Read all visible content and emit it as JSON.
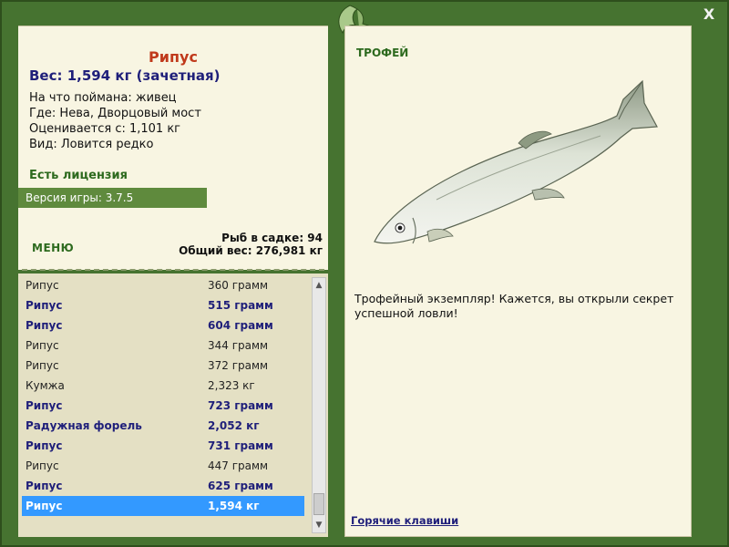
{
  "fish": {
    "name": "Рипус",
    "weight_line": "Вес: 1,594 кг (зачетная)",
    "info": [
      "На что поймана: живец",
      "Где: Нева, Дворцовый мост",
      "Оценивается с: 1,101 кг",
      "Вид: Ловится редко"
    ]
  },
  "license": "Есть лицензия",
  "version": "Версия игры: 3.7.5",
  "menu_label": "МЕНЮ",
  "stats": {
    "count_line": "Рыб в садке: 94",
    "total_line": "Общий вес: 276,981 кг"
  },
  "list": [
    {
      "name": "Рипус",
      "weight": "360 грамм",
      "bold": false
    },
    {
      "name": "Рипус",
      "weight": "515 грамм",
      "bold": true
    },
    {
      "name": "Рипус",
      "weight": "604 грамм",
      "bold": true
    },
    {
      "name": "Рипус",
      "weight": "344 грамм",
      "bold": false
    },
    {
      "name": "Рипус",
      "weight": "372 грамм",
      "bold": false
    },
    {
      "name": "Кумжа",
      "weight": "2,323 кг",
      "bold": false
    },
    {
      "name": "Рипус",
      "weight": "723 грамм",
      "bold": true
    },
    {
      "name": "Радужная форель",
      "weight": "2,052 кг",
      "bold": true
    },
    {
      "name": "Рипус",
      "weight": "731 грамм",
      "bold": true
    },
    {
      "name": "Рипус",
      "weight": "447 грамм",
      "bold": false
    },
    {
      "name": "Рипус",
      "weight": "625 грамм",
      "bold": true
    },
    {
      "name": "Рипус",
      "weight": "1,594 кг",
      "bold": true,
      "selected": true
    }
  ],
  "trophy": {
    "label": "ТРОФЕЙ",
    "text": "Трофейный экземпляр! Кажется, вы открыли секрет успешной ловли!"
  },
  "hotkeys": "Горячие клавиши",
  "close_glyph": "X"
}
